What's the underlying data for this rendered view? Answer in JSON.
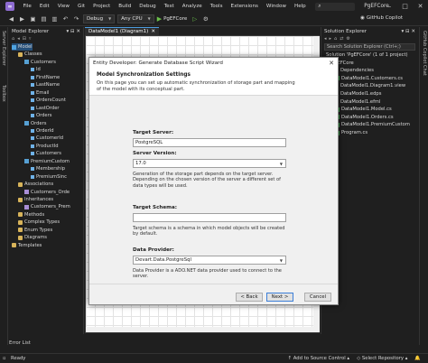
{
  "menu": {
    "items": [
      "File",
      "Edit",
      "View",
      "Git",
      "Project",
      "Build",
      "Debug",
      "Test",
      "Analyze",
      "Tools",
      "Extensions",
      "Window",
      "Help"
    ],
    "search_icon": "search-icon",
    "solution_name": "PgEFCore"
  },
  "toolbar": {
    "config": "Debug",
    "platform": "Any CPU",
    "run_target": "PgEFCore",
    "copilot_label": "GitHub Copilot"
  },
  "left_strip": {
    "server_explorer": "Server Explorer",
    "toolbox": "Toolbox"
  },
  "model_explorer": {
    "title": "Model Explorer",
    "tree": [
      {
        "label": "Model",
        "level": 0,
        "icon": "model"
      },
      {
        "label": "Classes",
        "level": 1,
        "icon": "folder"
      },
      {
        "label": "Customers",
        "level": 2,
        "icon": "entity"
      },
      {
        "label": "Id",
        "level": 3,
        "icon": "prop"
      },
      {
        "label": "FirstName",
        "level": 3,
        "icon": "prop"
      },
      {
        "label": "LastName",
        "level": 3,
        "icon": "prop"
      },
      {
        "label": "Email",
        "level": 3,
        "icon": "prop"
      },
      {
        "label": "OrdersCount",
        "level": 3,
        "icon": "prop"
      },
      {
        "label": "LastOrder",
        "level": 3,
        "icon": "prop"
      },
      {
        "label": "Orders",
        "level": 3,
        "icon": "prop"
      },
      {
        "label": "Orders",
        "level": 2,
        "icon": "entity"
      },
      {
        "label": "OrderId",
        "level": 3,
        "icon": "prop"
      },
      {
        "label": "CustomerId",
        "level": 3,
        "icon": "prop"
      },
      {
        "label": "ProductId",
        "level": 3,
        "icon": "prop"
      },
      {
        "label": "Customers",
        "level": 3,
        "icon": "prop"
      },
      {
        "label": "PremiumCustom",
        "level": 2,
        "icon": "entity"
      },
      {
        "label": "Membership",
        "level": 3,
        "icon": "prop"
      },
      {
        "label": "PremiumSinc",
        "level": 3,
        "icon": "prop"
      },
      {
        "label": "Associations",
        "level": 1,
        "icon": "folder"
      },
      {
        "label": "Customers_Orde",
        "level": 2,
        "icon": "assoc"
      },
      {
        "label": "Inheritances",
        "level": 1,
        "icon": "folder"
      },
      {
        "label": "Customers_Prem",
        "level": 2,
        "icon": "assoc"
      },
      {
        "label": "Methods",
        "level": 1,
        "icon": "folder"
      },
      {
        "label": "Complex Types",
        "level": 1,
        "icon": "folder"
      },
      {
        "label": "Enum Types",
        "level": 1,
        "icon": "folder"
      },
      {
        "label": "Diagrams",
        "level": 1,
        "icon": "folder"
      },
      {
        "label": "Templates",
        "level": 0,
        "icon": "folder"
      }
    ]
  },
  "doc_tab": {
    "label": "DataModel1 (Diagram1)"
  },
  "solution_explorer": {
    "title": "Solution Explorer",
    "search_placeholder": "Search Solution Explorer (Ctrl+;)",
    "items": [
      {
        "label": "Solution 'PgEFCore' (1 of 1 project)",
        "level": 0,
        "icon": "sln"
      },
      {
        "label": "PgEFCore",
        "level": 1,
        "icon": "proj"
      },
      {
        "label": "Dependencies",
        "level": 2,
        "icon": "file"
      },
      {
        "label": "DataModel1.Customers.cs",
        "level": 2,
        "icon": "cs"
      },
      {
        "label": "DataModel1.Diagram1.view",
        "level": 2,
        "icon": "file"
      },
      {
        "label": "DataModel1.edps",
        "level": 2,
        "icon": "file"
      },
      {
        "label": "DataModel1.efml",
        "level": 2,
        "icon": "file"
      },
      {
        "label": "DataModel1.Model.cs",
        "level": 2,
        "icon": "cs"
      },
      {
        "label": "DataModel1.Orders.cs",
        "level": 2,
        "icon": "cs"
      },
      {
        "label": "DataModel1.PremiumCustom",
        "level": 2,
        "icon": "cs"
      },
      {
        "label": "Program.cs",
        "level": 2,
        "icon": "cs"
      }
    ]
  },
  "right_strip": {
    "copilot_chat": "GitHub Copilot Chat"
  },
  "bottom": {
    "error_list": "Error List",
    "status": "Ready",
    "source_control": "Add to Source Control",
    "repository": "Select Repository"
  },
  "dialog": {
    "title": "Entity Developer: Generate Database Script Wizard",
    "heading": "Model Synchronization Settings",
    "subtitle": "On this page you can set up automatic synchronization of storage part and mapping of the model with its conceptual part.",
    "target_server_label": "Target Server:",
    "target_server_value": "PostgreSQL",
    "server_version_label": "Server Version:",
    "server_version_value": "17.0",
    "server_help": "Generation of the storage part depends on the target server. Depending on the chosen version of the server a different set of data types will be used.",
    "target_schema_label": "Target Schema:",
    "target_schema_value": "",
    "schema_help": "Target schema is a schema in which model objects will be created by default.",
    "data_provider_label": "Data Provider:",
    "data_provider_value": "Devart.Data.PostgreSql",
    "provider_help": "Data Provider is a ADO.NET data provider used to connect to the server.",
    "back_label": "< Back",
    "next_label": "Next >",
    "cancel_label": "Cancel"
  }
}
